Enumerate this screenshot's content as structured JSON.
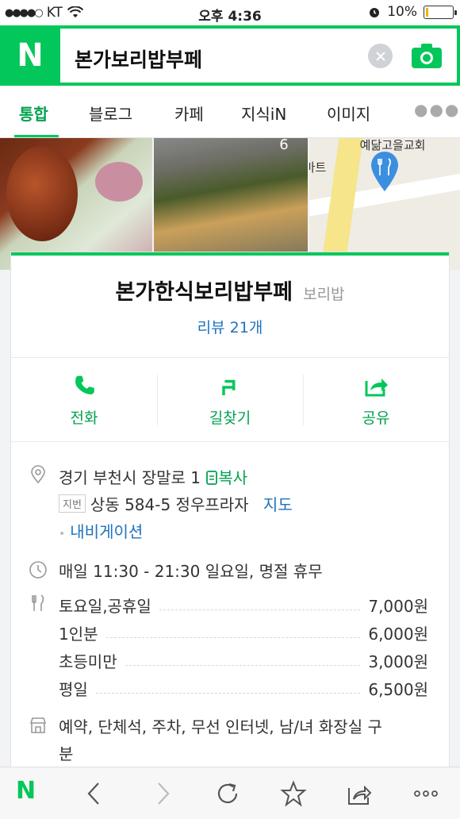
{
  "status_bar": {
    "carrier_dots": "●●●●○",
    "carrier": "KT",
    "time": "오후 4:36",
    "battery": "10%",
    "battery_level": 0.1
  },
  "header": {
    "logo": "N",
    "query": "본가보리밥부페"
  },
  "tabs": [
    {
      "label": "통합",
      "active": true
    },
    {
      "label": "블로그"
    },
    {
      "label": "카페"
    },
    {
      "label": "지식iN"
    },
    {
      "label": "이미지"
    }
  ],
  "photos": {
    "photo_count": "6",
    "map_label_1": "예닮고을교회",
    "map_label_2": "마트"
  },
  "place": {
    "name": "본가한식보리밥부페",
    "category": "보리밥",
    "review_link": "리뷰 21개"
  },
  "actions": {
    "call": "전화",
    "directions": "길찾기",
    "share": "공유"
  },
  "address": {
    "road": "경기 부천시 장말로 1",
    "copy": "복사",
    "jibeon_tag": "지번",
    "jibeon": "상동 584-5 정우프라자",
    "map": "지도",
    "navi": "내비게이션"
  },
  "hours": "매일 11:30 - 21:30 일요일, 명절 휴무",
  "menu": [
    {
      "name": "토요일,공휴일",
      "price": "7,000원"
    },
    {
      "name": "1인분",
      "price": "6,000원"
    },
    {
      "name": "초등미만",
      "price": "3,000원"
    },
    {
      "name": "평일",
      "price": "6,500원"
    }
  ],
  "facilities_line1": "예약, 단체석, 주차, 무선 인터넷, 남/녀 화장실 구",
  "facilities_line2": "분",
  "toolbar": {
    "logo": "N"
  },
  "colors": {
    "brand_green": "#03c75a",
    "link_blue": "#1e73be"
  }
}
